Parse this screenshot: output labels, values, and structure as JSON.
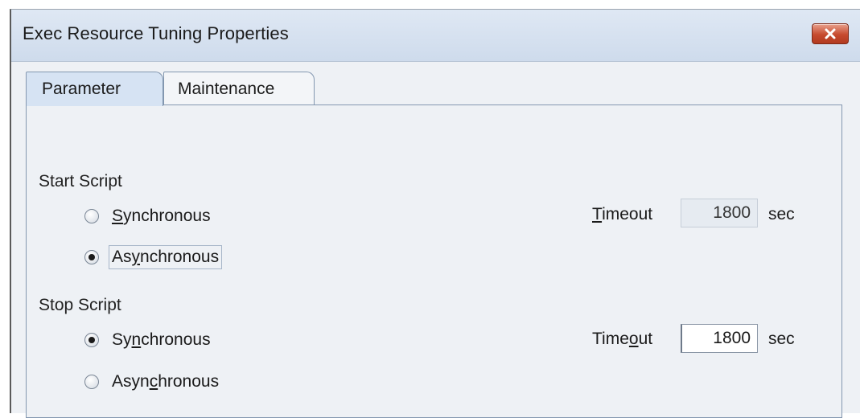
{
  "window": {
    "title": "Exec Resource Tuning Properties"
  },
  "icons": {
    "close": "close-icon"
  },
  "colors": {
    "close_button": "#c64a2e",
    "active_tab": "#d6e3f3",
    "window_bg": "#eef1f5"
  },
  "tabs": [
    {
      "label": "Parameter",
      "active": true
    },
    {
      "label": "Maintenance",
      "active": false
    }
  ],
  "start_script": {
    "label": "Start Script",
    "options": [
      {
        "label": "Synchronous",
        "mnemonic": "S",
        "checked": false
      },
      {
        "label": "Asynchronous",
        "mnemonic": "y",
        "checked": true
      }
    ],
    "timeout_label": "Timeout",
    "timeout_mnemonic": "T",
    "timeout_value": "1800",
    "timeout_enabled": false,
    "unit": "sec"
  },
  "stop_script": {
    "label": "Stop Script",
    "options": [
      {
        "label": "Synchronous",
        "mnemonic": "n",
        "checked": true
      },
      {
        "label": "Asynchronous",
        "mnemonic": "c",
        "checked": false
      }
    ],
    "timeout_label": "Timeout",
    "timeout_mnemonic": "o",
    "timeout_value": "1800",
    "timeout_enabled": true,
    "unit": "sec"
  }
}
